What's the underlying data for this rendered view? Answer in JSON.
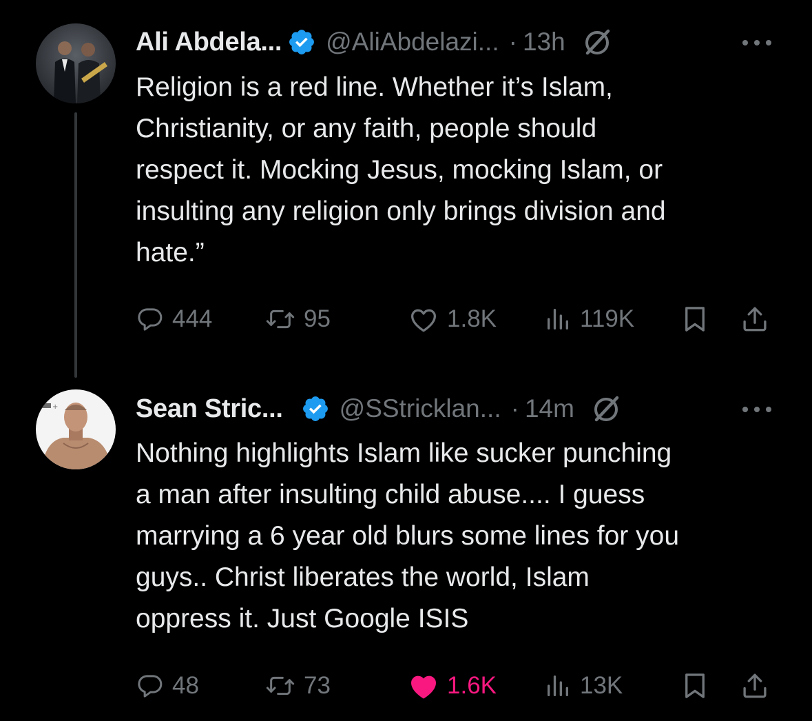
{
  "colors": {
    "background": "#000000",
    "text_primary": "#e7e9ea",
    "text_secondary": "#71767b",
    "verified_blue": "#1d9bf0",
    "like_pink": "#f91880",
    "thread_line": "#333639"
  },
  "tweets": [
    {
      "author_name": "Ali Abdela...",
      "handle": "@AliAbdelazi...",
      "separator": "·",
      "time": "13h",
      "verified": true,
      "avatar_icon": "avatar-photo",
      "text": "Religion is a red line. Whether it’s Islam,\nChristianity, or any faith, people should\nrespect it. Mocking Jesus, mocking Islam, or\ninsulting any religion only brings division and\nhate.”",
      "actions": {
        "replies": "444",
        "reposts": "95",
        "likes": "1.8K",
        "views": "119K",
        "liked": false
      }
    },
    {
      "author_name": "Sean Stric...",
      "handle": "@SStricklan...",
      "separator": "·",
      "time": "14m",
      "verified": true,
      "avatar_icon": "avatar-photo",
      "text": "Nothing highlights Islam like sucker punching\na man after insulting child abuse.... I guess\nmarrying a 6 year old blurs some lines for you\nguys.. Christ liberates the world, Islam\noppress it. Just Google ISIS",
      "actions": {
        "replies": "48",
        "reposts": "73",
        "likes": "1.6K",
        "views": "13K",
        "liked": true
      }
    }
  ],
  "icons": [
    "verified-badge-icon",
    "grok-icon",
    "more-icon",
    "reply-icon",
    "repost-icon",
    "like-icon",
    "views-icon",
    "bookmark-icon",
    "share-icon"
  ]
}
